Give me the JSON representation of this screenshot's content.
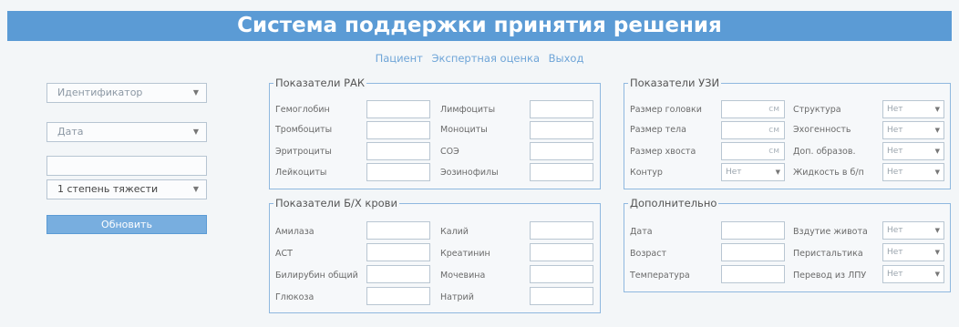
{
  "header": {
    "title": "Система поддержки принятия решения"
  },
  "nav": {
    "patient": "Пациент",
    "expert": "Экспертная оценка",
    "exit": "Выход"
  },
  "left": {
    "id_placeholder": "Идентификатор",
    "date_placeholder": "Дата",
    "empty_value": "",
    "severity_value": "1 степень тяжести",
    "update_label": "Обновить"
  },
  "rak": {
    "title": "Показатели РАК",
    "labels_left": [
      "Гемоглобин",
      "Тромбоциты",
      "Эритроциты",
      "Лейкоциты"
    ],
    "labels_right": [
      "Лимфоциты",
      "Моноциты",
      "СОЭ",
      "Эозинофилы"
    ]
  },
  "bh": {
    "title": "Показатели Б/Х крови",
    "labels_left": [
      "Амилаза",
      "АСТ",
      "Билирубин общий",
      "Глюкоза"
    ],
    "labels_right": [
      "Калий",
      "Креатинин",
      "Мочевина",
      "Натрий"
    ]
  },
  "uzi": {
    "title": "Показатели УЗИ",
    "labels_left": [
      "Размер головки",
      "Размер тела",
      "Размер хвоста",
      "Контур"
    ],
    "unit": "см",
    "kontur_value": "Нет",
    "labels_right": [
      "Структура",
      "Эхогенность",
      "Доп. образов.",
      "Жидкость в б/п"
    ],
    "right_values": [
      "Нет",
      "Нет",
      "Нет",
      "Нет"
    ]
  },
  "extra": {
    "title": "Дополнительно",
    "labels_left": [
      "Дата",
      "Возраст",
      "Температура"
    ],
    "labels_right": [
      "Вздутие живота",
      "Перистальтика",
      "Перевод из ЛПУ"
    ],
    "right_values": [
      "Нет",
      "Нет",
      "Нет"
    ]
  },
  "icons": {
    "dropdown": "chevron-down-icon"
  }
}
